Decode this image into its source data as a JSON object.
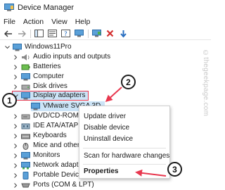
{
  "window": {
    "title": "Device Manager"
  },
  "menu": {
    "file": "File",
    "action": "Action",
    "view": "View",
    "help": "Help"
  },
  "tree": {
    "root": "Windows11Pro",
    "items": [
      "Audio inputs and outputs",
      "Batteries",
      "Computer",
      "Disk drives",
      "Display adapters",
      "VMware SVGA 3D",
      "DVD/CD-ROM drive",
      "IDE ATA/ATAPI co",
      "Keyboards",
      "Mice and other p",
      "Monitors",
      "Network adapters",
      "Portable Devices",
      "Ports (COM & LPT)"
    ]
  },
  "context_menu": {
    "update": "Update driver",
    "disable": "Disable device",
    "uninstall": "Uninstall device",
    "scan": "Scan for hardware changes",
    "properties": "Properties"
  },
  "callouts": {
    "one": "1",
    "two": "2",
    "three": "3"
  },
  "watermark": "©thegeekpage.com",
  "colors": {
    "highlight": "#cce4f7",
    "callout_outline": "#e8384f",
    "arrow": "#e8384f"
  }
}
